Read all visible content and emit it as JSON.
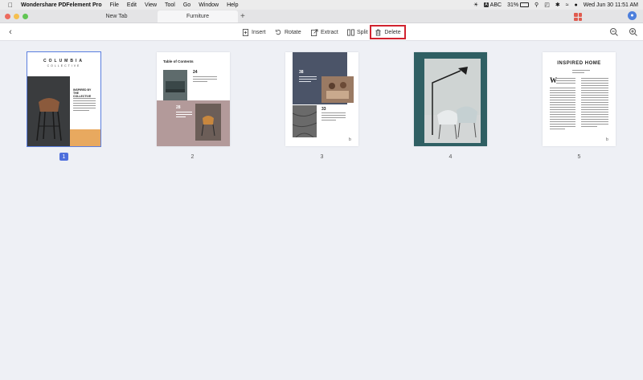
{
  "menubar": {
    "app_name": "Wondershare PDFelement Pro",
    "items": [
      "File",
      "Edit",
      "View",
      "Tool",
      "Go",
      "Window",
      "Help"
    ],
    "status": {
      "input_source": "ABC",
      "battery": "31%",
      "datetime": "Wed Jun 30  11:51 AM"
    }
  },
  "tabs": {
    "new_tab": "New Tab",
    "active_tab": "Furniture"
  },
  "toolbar": {
    "insert": "Insert",
    "rotate": "Rotate",
    "extract": "Extract",
    "split": "Split",
    "delete": "Delete",
    "highlight_color": "#d1232f"
  },
  "pages": [
    {
      "number": "1",
      "selected": true
    },
    {
      "number": "2",
      "selected": false
    },
    {
      "number": "3",
      "selected": false
    },
    {
      "number": "4",
      "selected": false
    },
    {
      "number": "5",
      "selected": false
    }
  ],
  "page1": {
    "title": "COLUMBIA",
    "subtitle": "COLLECTIVE",
    "heading": "INSPIRED BY THE COLLECTIVE"
  },
  "page2": {
    "title": "Table of Contents",
    "num_a": "24",
    "num_b": "28"
  },
  "page3": {
    "num_a": "38",
    "num_b": "33"
  },
  "page5": {
    "title": "INSPIRED HOME",
    "dropcap": "W",
    "page_letter": "b"
  },
  "page3_letter": "b"
}
